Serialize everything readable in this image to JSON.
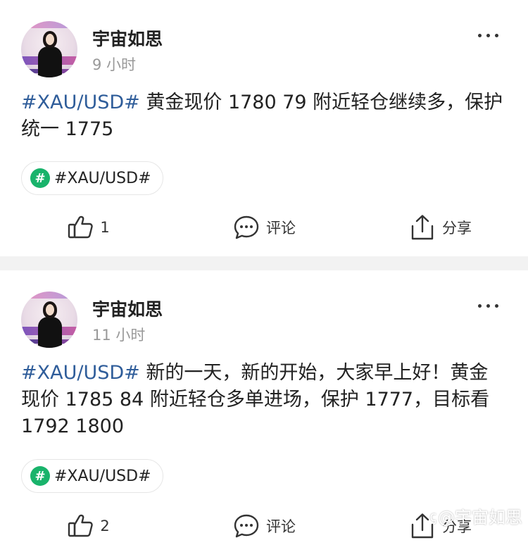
{
  "posts": [
    {
      "username": "宇宙如思",
      "time": "9 小时",
      "hashtag": "#XAU/USD#",
      "text": "黄金现价 1780 79 附近轻仓继续多，保护统一 1775",
      "tag_label": "#XAU/USD#",
      "tag_icon": "#",
      "like_count": "1",
      "comment_label": "评论",
      "share_label": "分享"
    },
    {
      "username": "宇宙如思",
      "time": "11 小时",
      "hashtag": "#XAU/USD#",
      "text": "新的一天，新的开始，大家早上好！黄金现价 1785 84 附近轻仓多单进场，保护 1777，目标看 1792 1800",
      "tag_label": "#XAU/USD#",
      "tag_icon": "#",
      "like_count": "2",
      "comment_label": "评论",
      "share_label": "分享"
    }
  ],
  "watermark": {
    "icon": "ꞔ",
    "text": "@宇宙如思"
  },
  "colors": {
    "hashtag": "#2f5d9a",
    "tag_icon_bg": "#19b36b",
    "time": "#999999",
    "divider": "#f2f2f2"
  }
}
